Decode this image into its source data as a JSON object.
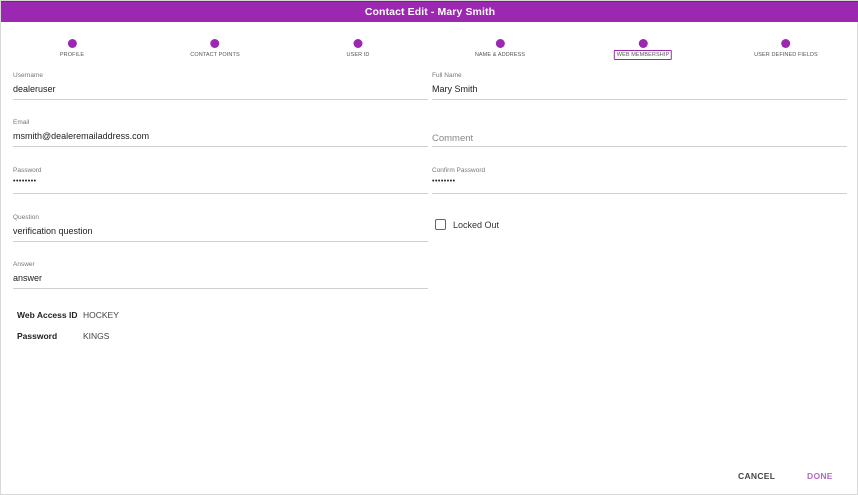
{
  "dialog": {
    "title": "Contact Edit - Mary Smith"
  },
  "stepper": {
    "steps": [
      {
        "label": "PROFILE"
      },
      {
        "label": "CONTACT POINTS"
      },
      {
        "label": "USER ID"
      },
      {
        "label": "NAME & ADDRESS"
      },
      {
        "label": "WEB MEMBERSHIP",
        "active": true
      },
      {
        "label": "USER DEFINED FIELDS"
      }
    ]
  },
  "form": {
    "username": {
      "label": "Username",
      "value": "dealeruser"
    },
    "full_name": {
      "label": "Full Name",
      "value": "Mary Smith"
    },
    "email": {
      "label": "Email",
      "value": "msmith@dealeremailaddress.com"
    },
    "comment": {
      "placeholder": "Comment"
    },
    "password": {
      "label": "Password",
      "value": "••••••••"
    },
    "confirm_password": {
      "label": "Confirm Password",
      "value": "••••••••"
    },
    "question": {
      "label": "Question",
      "value": "verification question"
    },
    "locked_out": {
      "label": "Locked Out",
      "checked": false
    },
    "answer": {
      "label": "Answer",
      "value": "answer"
    }
  },
  "web_access": {
    "id_label": "Web Access ID",
    "id_value": "HOCKEY",
    "password_label": "Password",
    "password_value": "KINGS"
  },
  "actions": {
    "cancel_label": "CANCEL",
    "done_label": "DONE"
  },
  "colors": {
    "accent": "#9c27b0",
    "done_text": "#b36ac2"
  }
}
